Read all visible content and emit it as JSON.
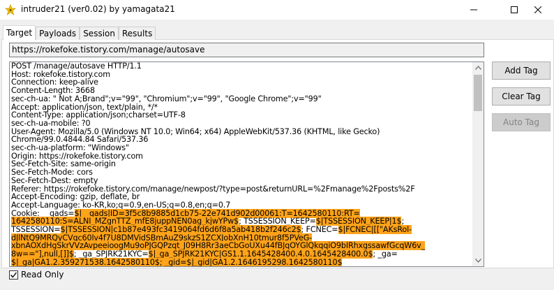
{
  "window": {
    "title": "intruder21  (ver0.02) by yamagata21",
    "icon": "app-icon"
  },
  "tabs": [
    {
      "label": "Target",
      "active": true
    },
    {
      "label": "Payloads",
      "active": false
    },
    {
      "label": "Session",
      "active": false
    },
    {
      "label": "Results",
      "active": false
    }
  ],
  "target": {
    "url": "https://rokefoke.tistory.com/manage/autosave",
    "request_lines": [
      [
        {
          "t": "POST /manage/autosave HTTP/1.1"
        }
      ],
      [
        {
          "t": "Host: rokefoke.tistory.com"
        }
      ],
      [
        {
          "t": "Connection: keep-alive"
        }
      ],
      [
        {
          "t": "Content-Length: 3668"
        }
      ],
      [
        {
          "t": "sec-ch-ua: \" Not A;Brand\";v=\"99\", \"Chromium\";v=\"99\", \"Google Chrome\";v=\"99\""
        }
      ],
      [
        {
          "t": "Accept: application/json, text/plain, */*"
        }
      ],
      [
        {
          "t": "Content-Type: application/json;charset=UTF-8"
        }
      ],
      [
        {
          "t": "sec-ch-ua-mobile: ?0"
        }
      ],
      [
        {
          "t": "User-Agent: Mozilla/5.0 (Windows NT 10.0; Win64; x64) AppleWebKit/537.36 (KHTML, like Gecko)"
        }
      ],
      [
        {
          "t": "Chrome/99.0.4844.84 Safari/537.36"
        }
      ],
      [
        {
          "t": "sec-ch-ua-platform: \"Windows\""
        }
      ],
      [
        {
          "t": "Origin: https://rokefoke.tistory.com"
        }
      ],
      [
        {
          "t": "Sec-Fetch-Site: same-origin"
        }
      ],
      [
        {
          "t": "Sec-Fetch-Mode: cors"
        }
      ],
      [
        {
          "t": "Sec-Fetch-Dest: empty"
        }
      ],
      [
        {
          "t": "Referer: https://rokefoke.tistory.com/manage/newpost/?type=post&returnURL=%2Fmanage%2Fposts%2F"
        }
      ],
      [
        {
          "t": "Accept-Encoding: gzip, deflate, br"
        }
      ],
      [
        {
          "t": "Accept-Language: ko-KR,ko;q=0.9,en-US;q=0.8,en;q=0.7"
        }
      ],
      [
        {
          "t": "Cookie: __gads="
        },
        {
          "t": "$|__gads|ID=3f5c8b9885d1cb75-22e741d902d00061:T=1642580110:RT=",
          "h": true
        }
      ],
      [
        {
          "t": "1642580110:S=ALNI_MZgnTTZ_mfE8juppNEN0ag_kjwYPw$",
          "h": true
        },
        {
          "t": "; TSSESSION_KEEP="
        },
        {
          "t": "$|TSSESSION_KEEP|1$",
          "h": true
        },
        {
          "t": ";"
        }
      ],
      [
        {
          "t": "TSSESSION="
        },
        {
          "t": "$|TSSESSION|c1b87e493fc3419064fd6d6f8a5ab418b2f246c2$",
          "h": true
        },
        {
          "t": "; FCNEC="
        },
        {
          "t": "$|FCNEC|[[\"AKsRol-",
          "h": true
        }
      ],
      [
        {
          "t": "dJlNtQ9MRQyCVqc60lv4f7U8DMVidSBmAuZ9skzS1ZCXJobXnH10tmur8f5PVeG-",
          "h": true
        }
      ],
      [
        {
          "t": "xbnAOXdHgSkrVVzAvpeeioogMu9oPJGQPzqt_J09H8Rr3aeCbGoUXu44fBJqOYGlQkqqiO9bIRhxgssawfGcqW6v_",
          "h": true
        }
      ],
      [
        {
          "t": "8w==\"],null,[]]$",
          "h": true
        },
        {
          "t": "; _ga_SPJRK21KYC="
        },
        {
          "t": "$|_ga_SPJRK21KYC|GS1.1.1645428400.4.0.1645428400.0$",
          "h": true
        },
        {
          "t": "; _ga="
        }
      ],
      [
        {
          "t": "$|_ga|GA1.2.359271538.1642580110$; _gid=$|_gid|GA1.2.1646195298.1642580110$",
          "h": true
        }
      ]
    ]
  },
  "buttons": {
    "add_tag": "Add Tag",
    "clear_tag": "Clear Tag",
    "auto_tag": "Auto Tag"
  },
  "readonly": {
    "label": "Read Only",
    "checked": true
  },
  "colors": {
    "highlight": "#ffa31a",
    "panel": "#ffffff",
    "window": "#f0f0f0"
  }
}
